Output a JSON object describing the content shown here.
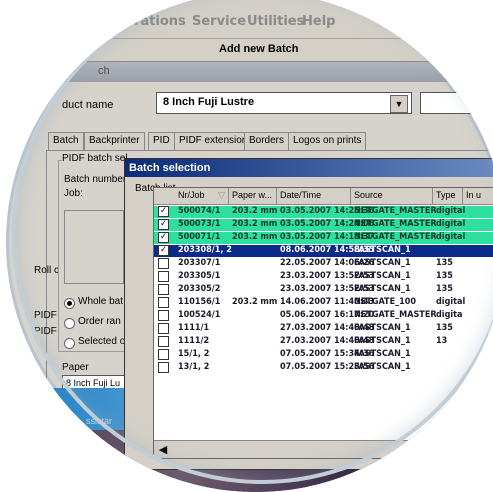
{
  "menu": {
    "items": [
      "rations",
      "Service",
      "Utilities",
      "Help"
    ],
    "add_batch_label": "Add new Batch",
    "band_text": "ch"
  },
  "product": {
    "label": "duct name",
    "value": "8 Inch Fuji Lustre",
    "dropdown_icon": "chevron-down-icon"
  },
  "left_labels": [
    "Roll c",
    "PIDF",
    "PIDF"
  ],
  "tabs": [
    "Batch",
    "Backprinter",
    "PID",
    "PIDF extension",
    "Borders",
    "Logos on prints"
  ],
  "batch_panel": {
    "group_title": "PIDF batch sel",
    "batch_number_label": "Batch number",
    "job_label": "Job:",
    "radios": [
      {
        "label": "Whole bat",
        "checked": true
      },
      {
        "label": "Order ran",
        "checked": false
      },
      {
        "label": "Selected o",
        "checked": false
      }
    ],
    "paper_label": "Paper",
    "paper_value": "8 Inch Fuji Lu",
    "assist_label": "ssistar"
  },
  "dialog": {
    "title": "Batch selection",
    "list_label": "Batch list",
    "columns": [
      "Nr/Job",
      "Paper w...",
      "Date/Time",
      "Source",
      "Type",
      "In u"
    ],
    "rows": [
      {
        "checked": true,
        "job": "500074/1",
        "paper": "203.2 mm",
        "datetime": "03.05.2007 14:25:36",
        "source": "NETGATE_MASTER",
        "type": "digital",
        "style": "green"
      },
      {
        "checked": true,
        "job": "500073/1",
        "paper": "203.2 mm",
        "datetime": "03.05.2007 14:24:06",
        "source": "NETGATE_MASTER",
        "type": "digital",
        "style": "green"
      },
      {
        "checked": true,
        "job": "500071/1",
        "paper": "203.2 mm",
        "datetime": "03.05.2007 14:18:37",
        "source": "NETGATE_MASTER",
        "type": "digital",
        "style": "green"
      },
      {
        "checked": true,
        "job": "203308/1, 2",
        "paper": "",
        "datetime": "08.06.2007 14:58:35",
        "source": "FASTSCAN_1",
        "type": "",
        "style": "selected"
      },
      {
        "checked": false,
        "job": "203307/1",
        "paper": "",
        "datetime": "22.05.2007 14:06:26",
        "source": "FASTSCAN_1",
        "type": "135",
        "style": "normal"
      },
      {
        "checked": false,
        "job": "203305/1",
        "paper": "",
        "datetime": "23.03.2007 13:52:53",
        "source": "FASTSCAN_1",
        "type": "135",
        "style": "normal"
      },
      {
        "checked": false,
        "job": "203305/2",
        "paper": "",
        "datetime": "23.03.2007 13:52:53",
        "source": "FASTSCAN_1",
        "type": "135",
        "style": "normal"
      },
      {
        "checked": false,
        "job": "110156/1",
        "paper": "203.2 mm",
        "datetime": "14.06.2007 11:40:43",
        "source": "NETGATE_100",
        "type": "digital",
        "style": "normal"
      },
      {
        "checked": false,
        "job": "100524/1",
        "paper": "",
        "datetime": "05.06.2007 16:17:20",
        "source": "NETGATE_MASTER",
        "type": "digita",
        "style": "normal"
      },
      {
        "checked": false,
        "job": "1111/1",
        "paper": "",
        "datetime": "27.03.2007 14:40:48",
        "source": "FASTSCAN_1",
        "type": "135",
        "style": "normal"
      },
      {
        "checked": false,
        "job": "1111/2",
        "paper": "",
        "datetime": "27.03.2007 14:40:48",
        "source": "FASTSCAN_1",
        "type": "13",
        "style": "normal"
      },
      {
        "checked": false,
        "job": "15/1, 2",
        "paper": "",
        "datetime": "07.05.2007 15:34:36",
        "source": "FASTSCAN_1",
        "type": "",
        "style": "normal"
      },
      {
        "checked": false,
        "job": "13/1, 2",
        "paper": "",
        "datetime": "07.05.2007 15:23:56",
        "source": "FASTSCAN_1",
        "type": "",
        "style": "normal"
      }
    ],
    "scroll_left_icon": "arrow-left-icon"
  },
  "colors": {
    "green_row": "#2ee0a0",
    "selected_row": "#0b2a8a",
    "title_bar": "#0b2a7a"
  }
}
